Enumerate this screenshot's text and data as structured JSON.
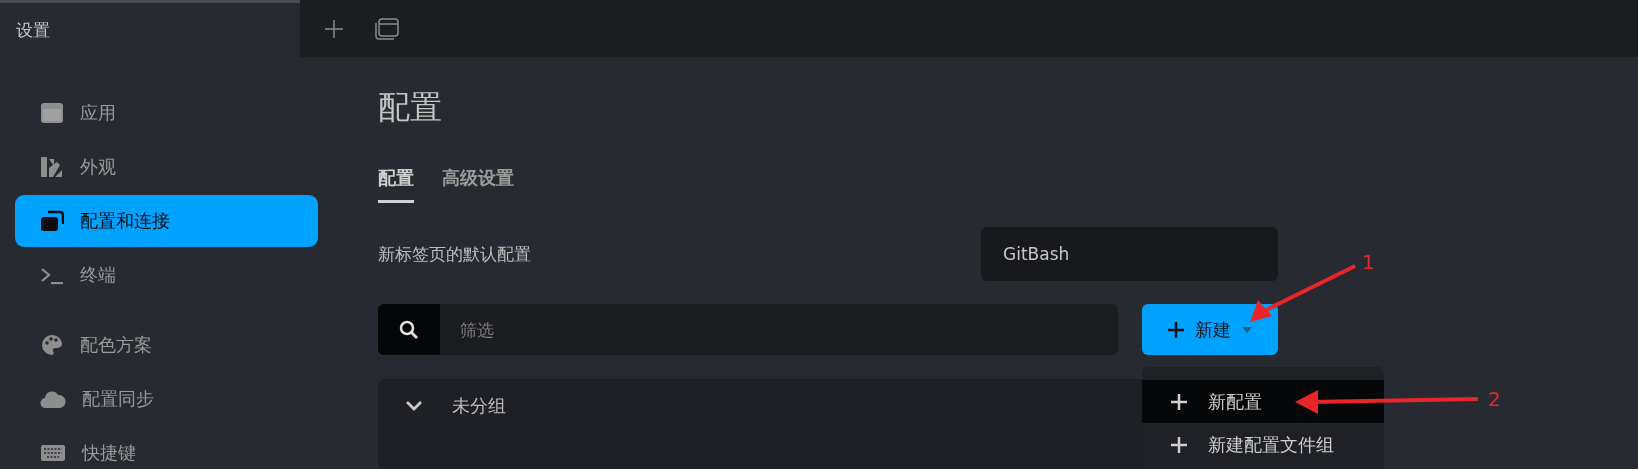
{
  "sidebar": {
    "title": "设置",
    "sections": [
      {
        "items": [
          {
            "label": "应用",
            "selected": false
          },
          {
            "label": "外观",
            "selected": false
          },
          {
            "label": "配置和连接",
            "selected": true
          },
          {
            "label": "终端",
            "selected": false
          }
        ]
      },
      {
        "items": [
          {
            "label": "配色方案",
            "selected": false
          },
          {
            "label": "配置同步",
            "selected": false
          },
          {
            "label": "快捷键",
            "selected": false
          }
        ]
      }
    ]
  },
  "page": {
    "title": "配置",
    "tabs": [
      {
        "label": "配置",
        "selected": true
      },
      {
        "label": "高级设置",
        "selected": false
      }
    ],
    "default_profile": {
      "label": "新标签页的默认配置",
      "value": "GitBash"
    },
    "filter": {
      "placeholder": "筛选"
    },
    "new_button": {
      "label": "新建"
    },
    "menu": [
      {
        "label": "新配置",
        "selected": true
      },
      {
        "label": "新建配置文件组",
        "selected": false
      }
    ],
    "group": {
      "label": "未分组",
      "expanded": true
    }
  },
  "annotations": [
    {
      "label": "1"
    },
    {
      "label": "2"
    }
  ]
}
